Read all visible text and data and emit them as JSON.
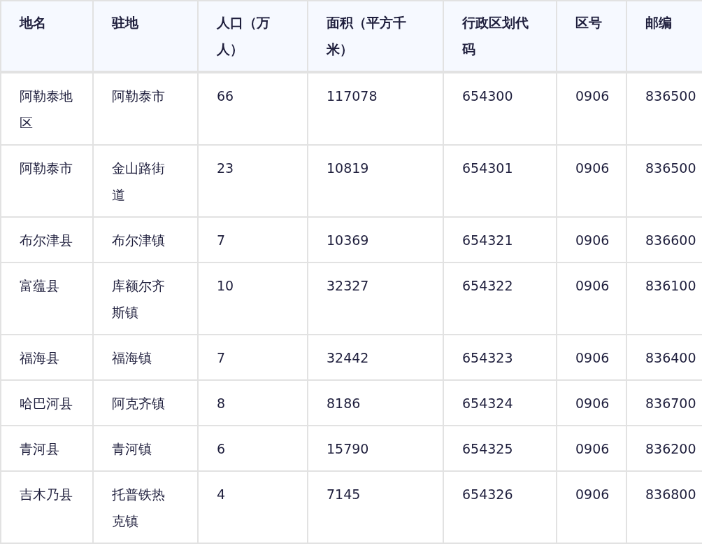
{
  "table": {
    "columns": [
      "地名",
      "驻地",
      "人口（万人）",
      "面积（平方千米）",
      "行政区划代码",
      "区号",
      "邮编"
    ],
    "rows": [
      [
        "阿勒泰地区",
        "阿勒泰市",
        "66",
        "117078",
        "654300",
        "0906",
        "836500"
      ],
      [
        "阿勒泰市",
        "金山路街道",
        "23",
        "10819",
        "654301",
        "0906",
        "836500"
      ],
      [
        "布尔津县",
        "布尔津镇",
        "7",
        "10369",
        "654321",
        "0906",
        "836600"
      ],
      [
        "富蕴县",
        "库额尔齐斯镇",
        "10",
        "32327",
        "654322",
        "0906",
        "836100"
      ],
      [
        "福海县",
        "福海镇",
        "7",
        "32442",
        "654323",
        "0906",
        "836400"
      ],
      [
        "哈巴河县",
        "阿克齐镇",
        "8",
        "8186",
        "654324",
        "0906",
        "836700"
      ],
      [
        "青河县",
        "青河镇",
        "6",
        "15790",
        "654325",
        "0906",
        "836200"
      ],
      [
        "吉木乃县",
        "托普铁热克镇",
        "4",
        "7145",
        "654326",
        "0906",
        "836800"
      ]
    ]
  }
}
